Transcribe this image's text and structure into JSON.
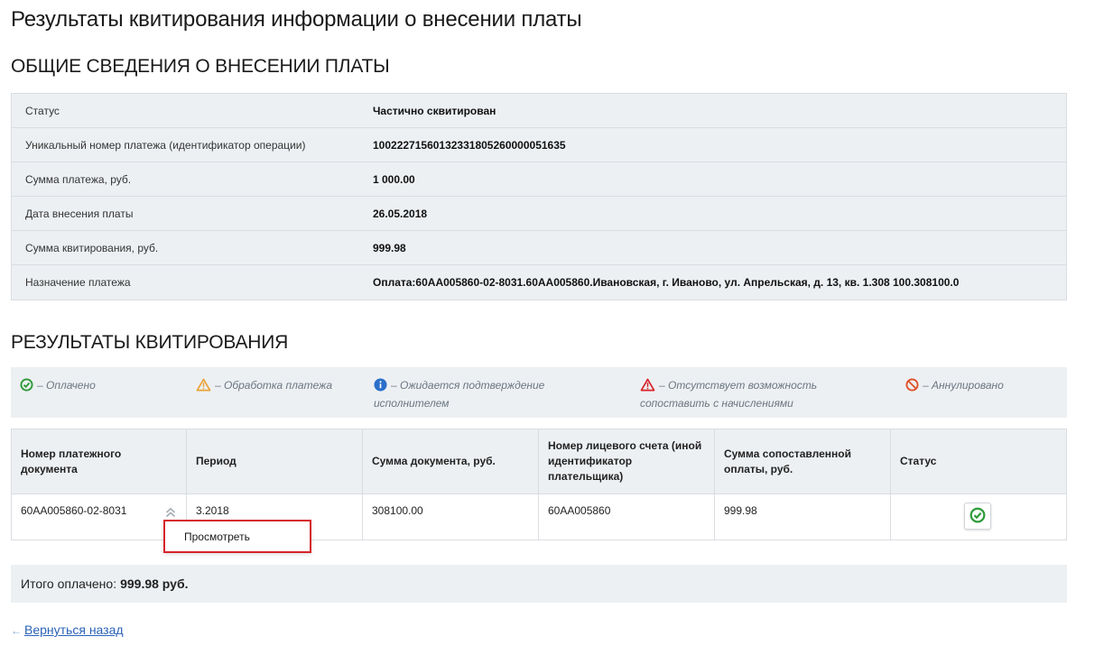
{
  "page": {
    "title": "Результаты квитирования информации о внесении платы"
  },
  "general": {
    "section_title": "ОБЩИЕ СВЕДЕНИЯ О ВНЕСЕНИИ ПЛАТЫ",
    "rows": [
      {
        "label": "Статус",
        "value": "Частично сквитирован"
      },
      {
        "label": "Уникальный номер платежа (идентификатор операции)",
        "value": "10022271560132331805260000051635"
      },
      {
        "label": "Сумма платежа, руб.",
        "value": "1 000.00"
      },
      {
        "label": "Дата внесения платы",
        "value": "26.05.2018"
      },
      {
        "label": "Сумма квитирования, руб.",
        "value": "999.98"
      },
      {
        "label": "Назначение платежа",
        "value": "Оплата:60АА005860-02-8031.60АА005860.Ивановская, г. Иваново, ул. Апрельская, д. 13, кв. 1.308 100.308100.0"
      }
    ]
  },
  "results": {
    "section_title": "РЕЗУЛЬТАТЫ КВИТИРОВАНИЯ",
    "legend": [
      {
        "icon": "check-circle-icon",
        "color": "#2e9b3a",
        "text": "– Оплачено"
      },
      {
        "icon": "warning-triangle-icon",
        "color": "#e8a33a",
        "text": "– Обработка платежа"
      },
      {
        "icon": "info-circle-icon",
        "color": "#2a6fc9",
        "text": "– Ожидается подтверждение исполнителем"
      },
      {
        "icon": "warning-triangle-red-icon",
        "color": "#d6232a",
        "text": "– Отсутствует возможность сопоставить с начислениями"
      },
      {
        "icon": "cancel-circle-icon",
        "color": "#e0522a",
        "text": "– Аннулировано"
      }
    ],
    "columns": [
      "Номер платежного документа",
      "Период",
      "Сумма документа, руб.",
      "Номер лицевого счета (иной идентификатор плательщика)",
      "Сумма сопоставленной оплаты, руб.",
      "Статус"
    ],
    "rows": [
      {
        "doc_number": "60АА005860-02-8031",
        "period": "3.2018",
        "doc_sum": "308100.00",
        "account": "60АА005860",
        "matched_sum": "999.98",
        "status_icon": "check-circle-icon"
      }
    ],
    "row_menu": {
      "view_label": "Просмотреть"
    },
    "total": {
      "label": "Итого оплачено:",
      "value": "999.98 руб."
    }
  },
  "nav": {
    "back_label": "Вернуться назад"
  }
}
